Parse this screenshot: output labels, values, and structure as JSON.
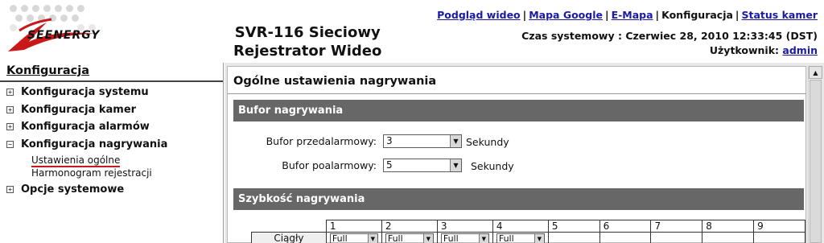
{
  "brand": {
    "logo_text": "SEENERGY"
  },
  "product": {
    "title_line1": "SVR-116 Sieciowy",
    "title_line2": "Rejestrator Wideo"
  },
  "top_nav": {
    "items": [
      {
        "label": "Podgląd wideo",
        "link": true
      },
      {
        "label": "Mapa Google",
        "link": true
      },
      {
        "label": "E-Mapa",
        "link": true
      },
      {
        "label": "Konfiguracja",
        "link": false
      },
      {
        "label": "Status kamer",
        "link": true
      }
    ],
    "separator": "|"
  },
  "system_time": {
    "label": "Czas systemowy :",
    "value": "Czerwiec 28, 2010 12:33:45 (DST)"
  },
  "user": {
    "label": "Użytkownik:",
    "name": "admin"
  },
  "sidebar": {
    "title": "Konfiguracja",
    "items": [
      {
        "label": "Konfiguracja systemu",
        "toggle": "+"
      },
      {
        "label": "Konfiguracja kamer",
        "toggle": "+"
      },
      {
        "label": "Konfiguracja alarmów",
        "toggle": "+"
      },
      {
        "label": "Konfiguracja nagrywania",
        "toggle": "−"
      },
      {
        "label": "Opcje systemowe",
        "toggle": "+"
      }
    ],
    "subitems": [
      {
        "label": "Ustawienia ogólne",
        "active": true
      },
      {
        "label": "Harmonogram rejestracji",
        "active": false
      }
    ]
  },
  "main": {
    "page_title": "Ogólne ustawienia nagrywania",
    "buffer_section": {
      "title": "Bufor nagrywania",
      "pre_alarm": {
        "label": "Bufor przedalarmowy:",
        "value": "3",
        "unit": "Sekundy"
      },
      "post_alarm": {
        "label": "Bufor poalarmowy:",
        "value": "5",
        "unit": "Sekundy"
      }
    },
    "rate_section": {
      "title": "Szybkość nagrywania",
      "columns": [
        "1",
        "2",
        "3",
        "4",
        "5",
        "6",
        "7",
        "8",
        "9"
      ],
      "row_label": "Ciągły",
      "values": [
        "Full",
        "Full",
        "Full",
        "Full",
        "",
        "",
        "",
        "",
        ""
      ]
    }
  },
  "colors": {
    "link": "#1a1aa6",
    "section_bar": "#676767",
    "active_underline": "#c8181a",
    "logo_red": "#c8181a"
  }
}
